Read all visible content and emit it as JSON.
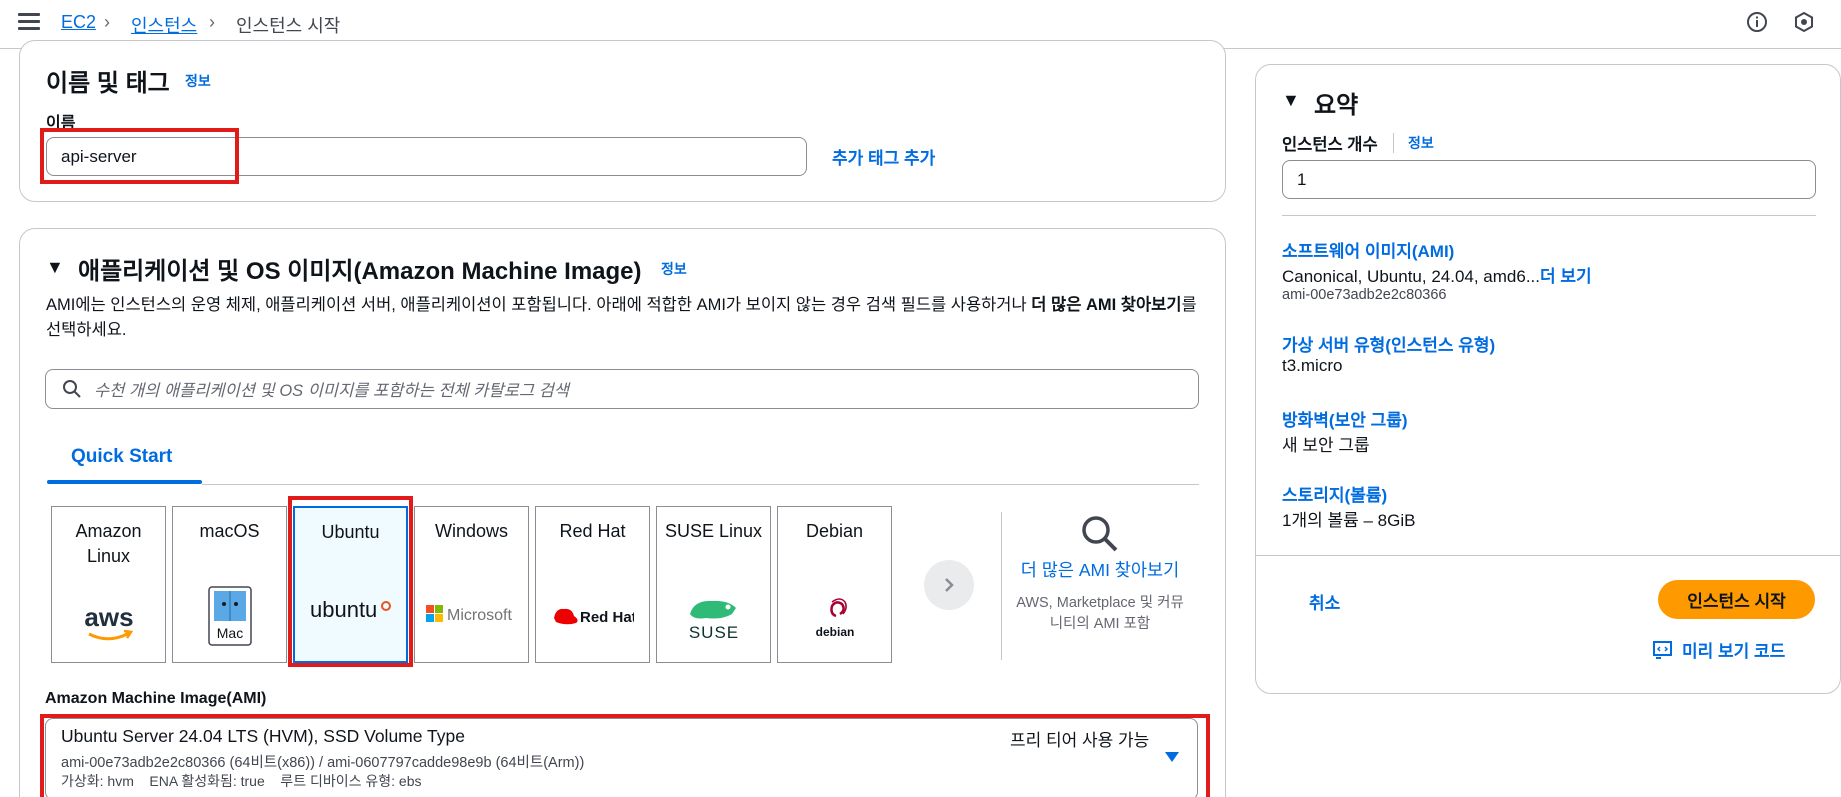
{
  "breadcrumb": {
    "items": [
      "EC2",
      "인스턴스"
    ],
    "current": "인스턴스 시작"
  },
  "name_tags": {
    "title": "이름 및 태그",
    "info": "정보",
    "name_label": "이름",
    "name_value": "api-server",
    "add_tags": "추가 태그 추가"
  },
  "ami": {
    "title": "애플리케이션 및 OS 이미지(Amazon Machine Image)",
    "info": "정보",
    "description_prefix": "AMI에는 인스턴스의 운영 체제, 애플리케이션 서버, 애플리케이션이 포함됩니다. 아래에 적합한 AMI가 보이지 않는 경우 검색 필드를 사용하거나 ",
    "description_bold": "더 많은 AMI 찾아보기",
    "description_suffix": "를 선택하세요.",
    "search_placeholder": "수천 개의 애플리케이션 및 OS 이미지를 포함하는 전체 카탈로그 검색",
    "tab": "Quick Start",
    "os_cards": [
      {
        "name": "Amazon Linux",
        "logo": "aws"
      },
      {
        "name": "macOS",
        "logo": "Mac"
      },
      {
        "name": "Ubuntu",
        "logo": "ubuntu"
      },
      {
        "name": "Windows",
        "logo": "Microsoft"
      },
      {
        "name": "Red Hat",
        "logo": "Red Hat"
      },
      {
        "name": "SUSE Linux",
        "logo": "SUSE"
      },
      {
        "name": "Debian",
        "logo": "debian"
      }
    ],
    "selected_os": "Ubuntu",
    "more_ami_link": "더 많은 AMI 찾아보기",
    "more_ami_sub": "AWS, Marketplace 및 커뮤니티의 AMI 포함",
    "ami_label": "Amazon Machine Image(AMI)",
    "selected_ami": {
      "name": "Ubuntu Server 24.04 LTS (HVM), SSD Volume Type",
      "free_tier": "프리 티어 사용 가능",
      "ids": "ami-00e73adb2e2c80366 (64비트(x86)) / ami-0607797cadde98e9b (64비트(Arm))",
      "meta": "가상화: hvm    ENA 활성화됨: true    루트 디바이스 유형: ebs"
    }
  },
  "summary": {
    "title": "요약",
    "instance_count_label": "인스턴스 개수",
    "info": "정보",
    "instance_count_value": "1",
    "software_image_label": "소프트웨어 이미지(AMI)",
    "software_image_value": "Canonical, Ubuntu, 24.04, amd6...",
    "see_more": "더 보기",
    "software_image_id": "ami-00e73adb2e2c80366",
    "instance_type_label": "가상 서버 유형(인스턴스 유형)",
    "instance_type_value": "t3.micro",
    "firewall_label": "방화벽(보안 그룹)",
    "firewall_value": "새 보안 그룹",
    "storage_label": "스토리지(볼륨)",
    "storage_value": "1개의 볼륨 – 8GiB",
    "cancel": "취소",
    "launch": "인스턴스 시작",
    "preview_code": "미리 보기 코드"
  },
  "colors": {
    "accent": "#006ce0",
    "primary_button": "#ff9900",
    "highlight": "#e11a1a"
  }
}
